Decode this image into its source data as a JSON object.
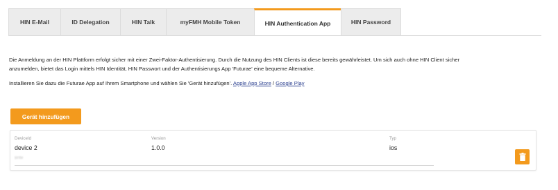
{
  "tabs": [
    {
      "label": "HIN E-Mail"
    },
    {
      "label": "ID Delegation"
    },
    {
      "label": "HIN Talk"
    },
    {
      "label": "myFMH Mobile Token"
    },
    {
      "label": "HIN Authentication App",
      "active": true
    },
    {
      "label": "HIN Password"
    }
  ],
  "intro": {
    "line1": "Die Anmeldung an der HIN Plattform erfolgt sicher mit einer Zwei-Faktor-Authentisierung. Durch die Nutzung des HIN Clients ist diese bereits gewährleistet. Um sich auch ohne HIN Client sicher",
    "line2": "anzumelden, bietet das Login mittels HIN Identität, HIN Passwort und der Authentisierungs App 'Futurae' eine bequeme Alternative."
  },
  "install": {
    "text": "Installieren Sie dazu die Futurae App auf Ihrem Smartphone und wählen Sie 'Gerät hinzufügen'.",
    "apple_link": "Apple App Store",
    "separator": "/",
    "google_link": "Google Play"
  },
  "add_device_label": "Gerät hinzufügen",
  "device": {
    "deviceid_label": "DeviceId",
    "deviceid_value": "device 2",
    "version_label": "Version",
    "version_value": "1.0.0",
    "type_label": "Typ",
    "type_value": "ios",
    "secondary_text": "Brite"
  },
  "colors": {
    "accent": "#f39a1d",
    "link": "#2a3f8f"
  },
  "icons": {
    "delete": "trash-icon"
  }
}
